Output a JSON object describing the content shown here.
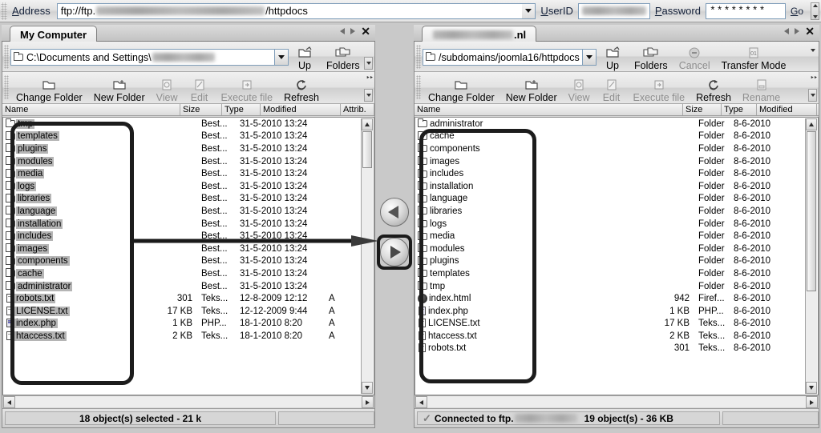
{
  "addressbar": {
    "label": "Address",
    "url_prefix": "ftp://ftp.",
    "url_suffix": "/httpdocs",
    "userid_label": "UserID",
    "userid_value": "",
    "password_label": "Password",
    "password_value": "********",
    "go_label": "Go",
    "dropdown_icon": "chevron-down-icon"
  },
  "left_panel": {
    "tab_label": "My Computer",
    "path_value": "C:\\Documents and Settings\\",
    "toolbar_row1": [
      {
        "label": "Up",
        "icon": "folder-up-icon",
        "enabled": true
      },
      {
        "label": "Folders",
        "icon": "folders-icon",
        "enabled": true
      }
    ],
    "toolbar_row2": [
      {
        "label": "Change Folder",
        "icon": "folder-icon",
        "enabled": true
      },
      {
        "label": "New Folder",
        "icon": "new-folder-icon",
        "enabled": true
      },
      {
        "label": "View",
        "icon": "view-icon",
        "enabled": false
      },
      {
        "label": "Edit",
        "icon": "edit-icon",
        "enabled": false
      },
      {
        "label": "Execute file",
        "icon": "execute-icon",
        "enabled": false
      },
      {
        "label": "Refresh",
        "icon": "refresh-icon",
        "enabled": true
      }
    ],
    "columns": [
      "Name",
      "Size",
      "Type",
      "Modified",
      "Attrib."
    ],
    "rows": [
      {
        "name": "tmp",
        "icon": "folder-icon",
        "size": "",
        "type": "Best...",
        "modified": "31-5-2010 13:24",
        "attrib": "",
        "selected": true
      },
      {
        "name": "templates",
        "icon": "folder-icon",
        "size": "",
        "type": "Best...",
        "modified": "31-5-2010 13:24",
        "attrib": "",
        "selected": true
      },
      {
        "name": "plugins",
        "icon": "folder-icon",
        "size": "",
        "type": "Best...",
        "modified": "31-5-2010 13:24",
        "attrib": "",
        "selected": true
      },
      {
        "name": "modules",
        "icon": "folder-icon",
        "size": "",
        "type": "Best...",
        "modified": "31-5-2010 13:24",
        "attrib": "",
        "selected": true
      },
      {
        "name": "media",
        "icon": "folder-icon",
        "size": "",
        "type": "Best...",
        "modified": "31-5-2010 13:24",
        "attrib": "",
        "selected": true
      },
      {
        "name": "logs",
        "icon": "folder-icon",
        "size": "",
        "type": "Best...",
        "modified": "31-5-2010 13:24",
        "attrib": "",
        "selected": true
      },
      {
        "name": "libraries",
        "icon": "folder-icon",
        "size": "",
        "type": "Best...",
        "modified": "31-5-2010 13:24",
        "attrib": "",
        "selected": true
      },
      {
        "name": "language",
        "icon": "folder-icon",
        "size": "",
        "type": "Best...",
        "modified": "31-5-2010 13:24",
        "attrib": "",
        "selected": true
      },
      {
        "name": "installation",
        "icon": "folder-icon",
        "size": "",
        "type": "Best...",
        "modified": "31-5-2010 13:24",
        "attrib": "",
        "selected": true
      },
      {
        "name": "includes",
        "icon": "folder-icon",
        "size": "",
        "type": "Best...",
        "modified": "31-5-2010 13:24",
        "attrib": "",
        "selected": true
      },
      {
        "name": "images",
        "icon": "folder-icon",
        "size": "",
        "type": "Best...",
        "modified": "31-5-2010 13:24",
        "attrib": "",
        "selected": true
      },
      {
        "name": "components",
        "icon": "folder-icon",
        "size": "",
        "type": "Best...",
        "modified": "31-5-2010 13:24",
        "attrib": "",
        "selected": true
      },
      {
        "name": "cache",
        "icon": "folder-icon",
        "size": "",
        "type": "Best...",
        "modified": "31-5-2010 13:24",
        "attrib": "",
        "selected": true
      },
      {
        "name": "administrator",
        "icon": "folder-icon",
        "size": "",
        "type": "Best...",
        "modified": "31-5-2010 13:24",
        "attrib": "",
        "selected": true
      },
      {
        "name": "robots.txt",
        "icon": "text-file-icon",
        "size": "301",
        "type": "Teks...",
        "modified": "12-8-2009 12:12",
        "attrib": "A",
        "selected": true
      },
      {
        "name": "LICENSE.txt",
        "icon": "text-file-icon",
        "size": "17 KB",
        "type": "Teks...",
        "modified": "12-12-2009 9:44",
        "attrib": "A",
        "selected": true
      },
      {
        "name": "index.php",
        "icon": "php-file-icon",
        "size": "1 KB",
        "type": "PHP...",
        "modified": "18-1-2010 8:20",
        "attrib": "A",
        "selected": true
      },
      {
        "name": "htaccess.txt",
        "icon": "text-file-icon",
        "size": "2 KB",
        "type": "Teks...",
        "modified": "18-1-2010 8:20",
        "attrib": "A",
        "selected": true
      }
    ],
    "status": "18 object(s) selected - 21 k"
  },
  "right_panel": {
    "tab_label": ".nl",
    "path_value": "/subdomains/joomla16/httpdocs",
    "toolbar_row1": [
      {
        "label": "Up",
        "icon": "folder-up-icon",
        "enabled": true
      },
      {
        "label": "Folders",
        "icon": "folders-icon",
        "enabled": true
      },
      {
        "label": "Cancel",
        "icon": "cancel-icon",
        "enabled": false
      },
      {
        "label": "Transfer Mode",
        "icon": "transfer-mode-icon",
        "enabled": true
      }
    ],
    "toolbar_row2": [
      {
        "label": "Change Folder",
        "icon": "folder-icon",
        "enabled": true
      },
      {
        "label": "New Folder",
        "icon": "new-folder-icon",
        "enabled": true
      },
      {
        "label": "View",
        "icon": "view-icon",
        "enabled": false
      },
      {
        "label": "Edit",
        "icon": "edit-icon",
        "enabled": false
      },
      {
        "label": "Execute file",
        "icon": "execute-icon",
        "enabled": false
      },
      {
        "label": "Refresh",
        "icon": "refresh-icon",
        "enabled": true
      },
      {
        "label": "Rename",
        "icon": "rename-icon",
        "enabled": false
      }
    ],
    "columns": [
      "Name",
      "Size",
      "Type",
      "Modified"
    ],
    "rows": [
      {
        "name": "administrator",
        "icon": "folder-icon",
        "size": "",
        "type": "Folder",
        "modified": "8-6-2010"
      },
      {
        "name": "cache",
        "icon": "folder-icon",
        "size": "",
        "type": "Folder",
        "modified": "8-6-2010"
      },
      {
        "name": "components",
        "icon": "folder-icon",
        "size": "",
        "type": "Folder",
        "modified": "8-6-2010"
      },
      {
        "name": "images",
        "icon": "folder-icon",
        "size": "",
        "type": "Folder",
        "modified": "8-6-2010"
      },
      {
        "name": "includes",
        "icon": "folder-icon",
        "size": "",
        "type": "Folder",
        "modified": "8-6-2010"
      },
      {
        "name": "installation",
        "icon": "folder-icon",
        "size": "",
        "type": "Folder",
        "modified": "8-6-2010"
      },
      {
        "name": "language",
        "icon": "folder-icon",
        "size": "",
        "type": "Folder",
        "modified": "8-6-2010"
      },
      {
        "name": "libraries",
        "icon": "folder-icon",
        "size": "",
        "type": "Folder",
        "modified": "8-6-2010"
      },
      {
        "name": "logs",
        "icon": "folder-icon",
        "size": "",
        "type": "Folder",
        "modified": "8-6-2010"
      },
      {
        "name": "media",
        "icon": "folder-icon",
        "size": "",
        "type": "Folder",
        "modified": "8-6-2010"
      },
      {
        "name": "modules",
        "icon": "folder-icon",
        "size": "",
        "type": "Folder",
        "modified": "8-6-2010"
      },
      {
        "name": "plugins",
        "icon": "folder-icon",
        "size": "",
        "type": "Folder",
        "modified": "8-6-2010"
      },
      {
        "name": "templates",
        "icon": "folder-icon",
        "size": "",
        "type": "Folder",
        "modified": "8-6-2010"
      },
      {
        "name": "tmp",
        "icon": "folder-icon",
        "size": "",
        "type": "Folder",
        "modified": "8-6-2010"
      },
      {
        "name": "index.html",
        "icon": "firefox-file-icon",
        "size": "942",
        "type": "Firef...",
        "modified": "8-6-2010"
      },
      {
        "name": "index.php",
        "icon": "php-file-icon",
        "size": "1 KB",
        "type": "PHP...",
        "modified": "8-6-2010"
      },
      {
        "name": "LICENSE.txt",
        "icon": "text-file-icon",
        "size": "17 KB",
        "type": "Teks...",
        "modified": "8-6-2010"
      },
      {
        "name": "htaccess.txt",
        "icon": "text-file-icon",
        "size": "2 KB",
        "type": "Teks...",
        "modified": "8-6-2010"
      },
      {
        "name": "robots.txt",
        "icon": "text-file-icon",
        "size": "301",
        "type": "Teks...",
        "modified": "8-6-2010"
      }
    ],
    "status_connected_prefix": "Connected to ftp.",
    "status_objects": "19 object(s) - 36 KB",
    "status_check_icon": "check-icon"
  },
  "transfer": {
    "download_icon": "arrow-left-circle-icon",
    "upload_icon": "arrow-right-circle-icon"
  },
  "annotations": {
    "selection_box": "highlight-rectangle",
    "upload_box": "highlight-rectangle",
    "arrow": "annotation-arrow"
  }
}
